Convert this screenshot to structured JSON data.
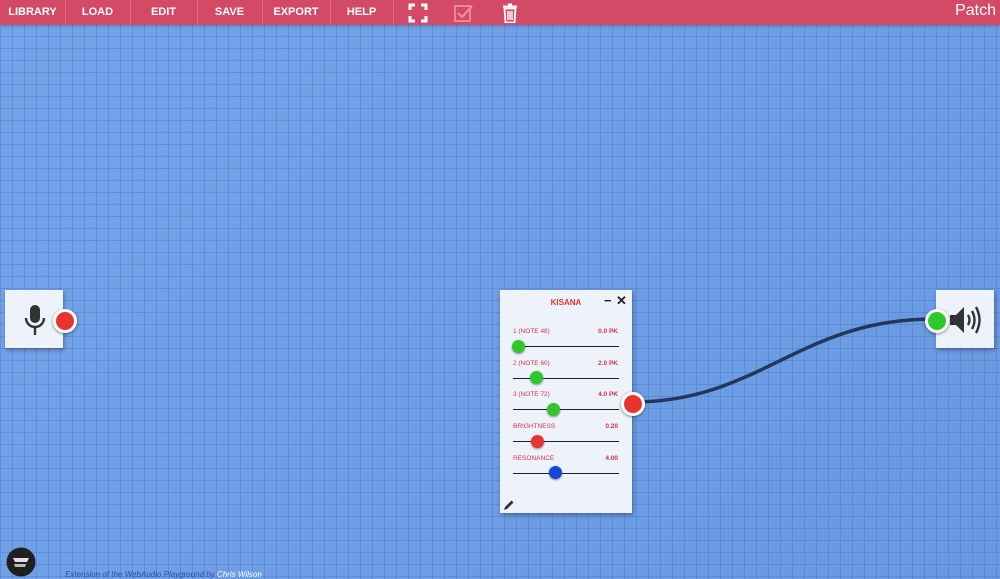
{
  "menu": {
    "items": [
      {
        "label": "LIBRARY"
      },
      {
        "label": "LOAD"
      },
      {
        "label": "EDIT"
      },
      {
        "label": "SAVE"
      },
      {
        "label": "EXPORT"
      },
      {
        "label": "HELP"
      }
    ],
    "icons": [
      "fullscreen-icon",
      "checkbox-icon",
      "trash-icon"
    ],
    "title": "Patch",
    "bar_color": "#d24a66"
  },
  "nodes": {
    "input": {
      "icon": "microphone-icon"
    },
    "output": {
      "icon": "speaker-icon"
    },
    "kisana": {
      "title": "KISANA",
      "minimize": "−",
      "close": "✕",
      "params": [
        {
          "label": "1 (NOTE 48)",
          "value": "0.0 PK",
          "level": 0.05,
          "knob_color": "#2ec82a"
        },
        {
          "label": "2 (NOTE 60)",
          "value": "2.0 PK",
          "level": 0.22,
          "knob_color": "#2ec82a"
        },
        {
          "label": "3 (NOTE 72)",
          "value": "4.0 PK",
          "level": 0.38,
          "knob_color": "#2ec82a"
        },
        {
          "label": "BRIGHTNESS",
          "value": "0.20",
          "level": 0.23,
          "knob_color": "#e8332e"
        },
        {
          "label": "RESONANCE",
          "value": "4.00",
          "level": 0.4,
          "knob_color": "#1646d8"
        }
      ],
      "edit_icon": "pencil-icon"
    }
  },
  "footer": {
    "text": "Extension of the WebAudio Playground by ",
    "link": "Chris Wilson",
    "logo_icon": "brand-logo-icon"
  }
}
